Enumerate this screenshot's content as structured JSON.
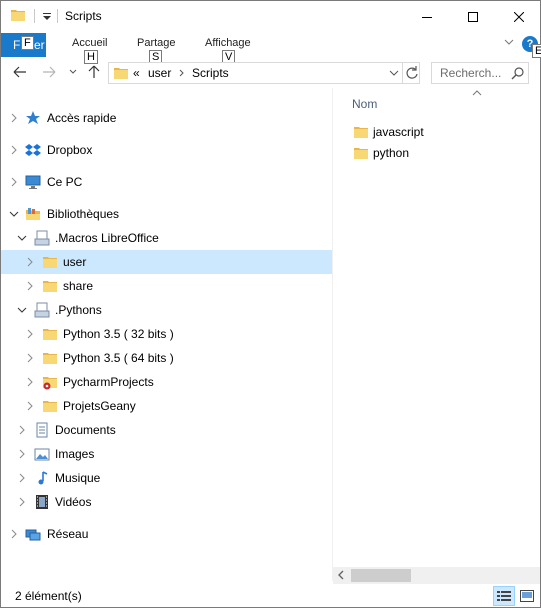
{
  "window": {
    "title": "Scripts"
  },
  "ribbon": {
    "file_tab": "Fichier",
    "file_tab_visible": "Fi",
    "file_tab_tail": "er",
    "tabs": [
      {
        "label": "Accueil",
        "keytip": "H"
      },
      {
        "label": "Partage",
        "keytip": "S"
      },
      {
        "label": "Affichage",
        "keytip": "V"
      }
    ],
    "file_keytip": "F",
    "help_keytip": "E"
  },
  "address": {
    "overflow": "«",
    "crumbs": [
      "user",
      "Scripts"
    ],
    "search_placeholder": "Recherch..."
  },
  "nav_tree": [
    {
      "label": "Accès rapide",
      "icon": "star-icon",
      "level": 0,
      "expanded": false
    },
    {
      "label": "Dropbox",
      "icon": "dropbox-icon",
      "level": 0,
      "expanded": false
    },
    {
      "label": "Ce PC",
      "icon": "computer-icon",
      "level": 0,
      "expanded": false
    },
    {
      "label": "Bibliothèques",
      "icon": "library-icon",
      "level": 0,
      "expanded": true
    },
    {
      "label": ".Macros LibreOffice",
      "icon": "library-doc-icon",
      "level": 1,
      "expanded": true
    },
    {
      "label": "user",
      "icon": "folder-icon",
      "level": 2,
      "expanded": false,
      "selected": true
    },
    {
      "label": "share",
      "icon": "folder-icon",
      "level": 2,
      "expanded": false
    },
    {
      "label": ".Pythons",
      "icon": "library-doc-icon",
      "level": 1,
      "expanded": true
    },
    {
      "label": "Python 3.5 ( 32 bits )",
      "icon": "folder-icon",
      "level": 2,
      "expanded": false
    },
    {
      "label": "Python 3.5 ( 64 bits )",
      "icon": "folder-icon",
      "level": 2,
      "expanded": false
    },
    {
      "label": "PycharmProjects",
      "icon": "folder-special-icon",
      "level": 2,
      "expanded": false
    },
    {
      "label": "ProjetsGeany",
      "icon": "folder-icon",
      "level": 2,
      "expanded": false
    },
    {
      "label": "Documents",
      "icon": "documents-icon",
      "level": 1,
      "expanded": false
    },
    {
      "label": "Images",
      "icon": "images-icon",
      "level": 1,
      "expanded": false
    },
    {
      "label": "Musique",
      "icon": "music-icon",
      "level": 1,
      "expanded": false
    },
    {
      "label": "Vidéos",
      "icon": "videos-icon",
      "level": 1,
      "expanded": false
    },
    {
      "label": "Réseau",
      "icon": "network-icon",
      "level": 0,
      "expanded": false
    }
  ],
  "content": {
    "column_header": "Nom",
    "files": [
      {
        "name": "javascript",
        "icon": "folder-icon"
      },
      {
        "name": "python",
        "icon": "folder-icon"
      }
    ]
  },
  "status": {
    "text": "2 élément(s)"
  },
  "colors": {
    "accent": "#1979ca",
    "selection": "#cce8ff",
    "folder": "#f8d775"
  }
}
